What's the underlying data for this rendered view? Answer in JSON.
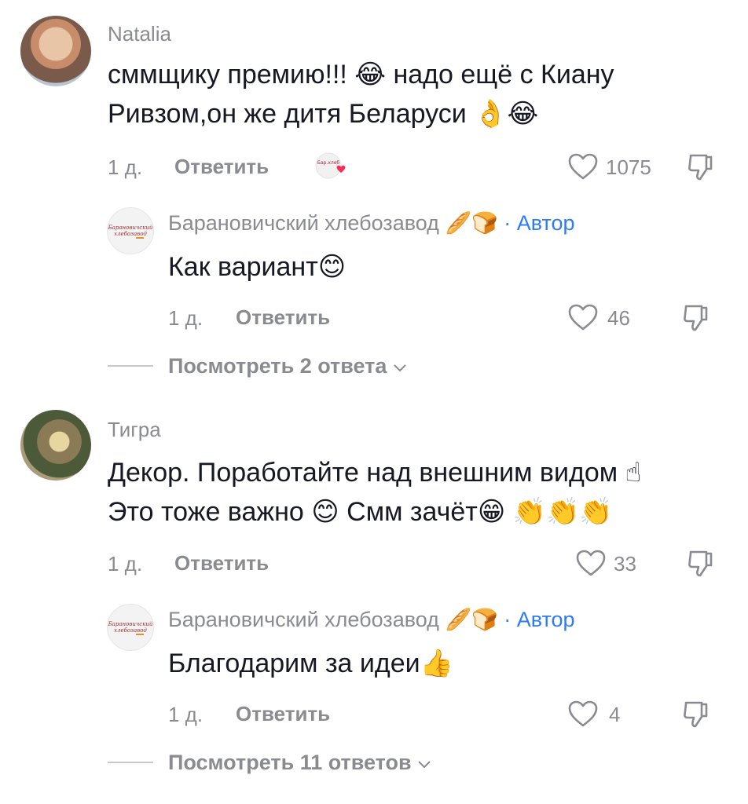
{
  "comments": [
    {
      "username": "Natalia",
      "text_line1": "сммщику премию!!! 😂 надо ещё с Киану",
      "text_line2": "Ривзом,он же дитя Беларуси 👌😂",
      "time": "1 д.",
      "reply_label": "Ответить",
      "likes": "1075",
      "reply": {
        "username": "Барановичский хлебозавод",
        "username_emoji": "🥖🍞",
        "author_badge": "· Автор",
        "text": "Как вариант😊",
        "time": "1 д.",
        "reply_label": "Ответить",
        "likes": "46"
      },
      "view_replies": "Посмотреть 2 ответа"
    },
    {
      "username": "Тигра",
      "text_line1": "Декор. Поработайте над внешним видом ☝",
      "text_line2": "Это тоже важно 😊 Смм зачёт😁 👏👏👏",
      "time": "1 д.",
      "reply_label": "Ответить",
      "likes": "33",
      "reply": {
        "username": "Барановичский хлебозавод",
        "username_emoji": "🥖🍞",
        "author_badge": "· Автор",
        "text": "Благодарим за идеи👍",
        "time": "1 д.",
        "reply_label": "Ответить",
        "likes": "4"
      },
      "view_replies": "Посмотреть 11 ответов"
    }
  ],
  "colors": {
    "text": "#161823",
    "muted": "#8a8b91",
    "accent": "#2d7cf4",
    "heart": "#fe2c55"
  }
}
